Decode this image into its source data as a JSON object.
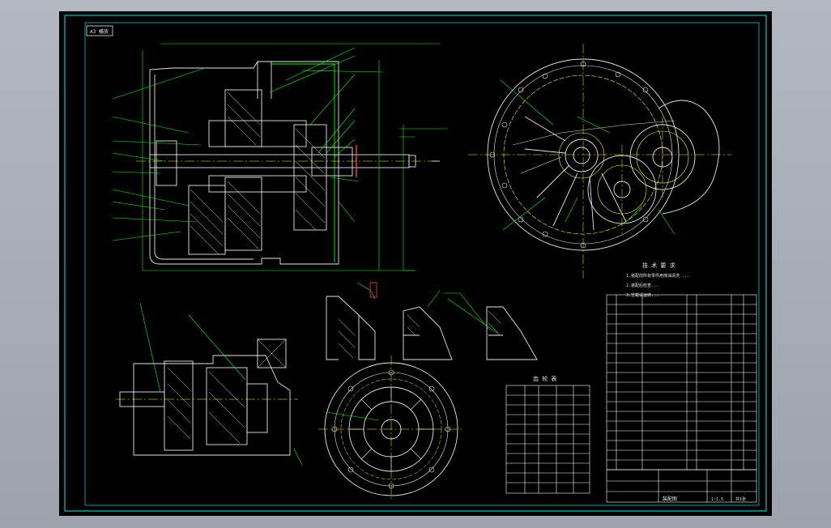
{
  "drawing": {
    "ref_box": "A3 横放",
    "tech_req_title": "技 术 要 求",
    "tech_req_lines": [
      "1.装配前所有零件用煤油清洗 ...",
      "2.装配后检查...",
      "3.空载试运转..."
    ],
    "gear_table_title": "齿 轮 表",
    "title_block": {
      "drawing_name": "装配图",
      "scale": "1:1.5",
      "sheet": "共1张"
    },
    "colors": {
      "background": "#000000",
      "frame": "#00c8c8",
      "outline": "#e6e6e6",
      "leader": "#00ff00",
      "center": "#ffff00",
      "section": "#ff4040",
      "table": "#ffffff"
    }
  }
}
